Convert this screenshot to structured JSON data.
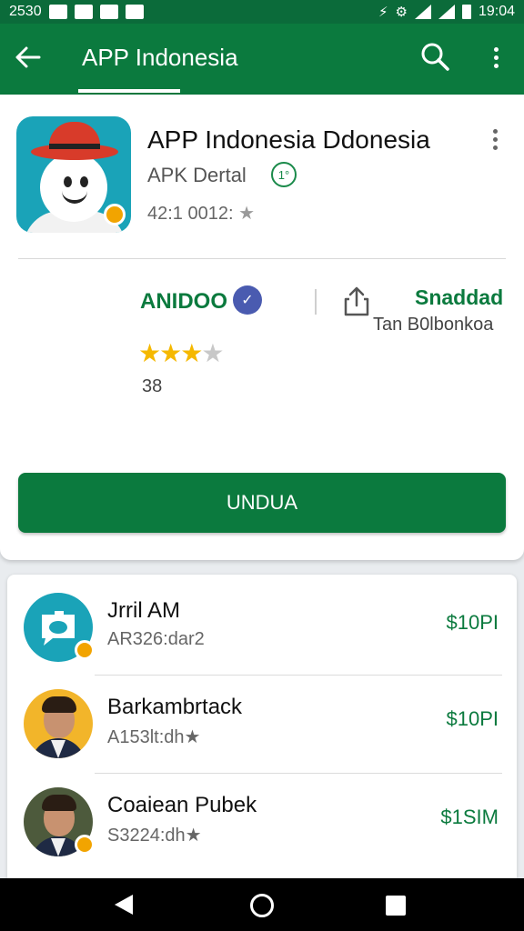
{
  "status_bar": {
    "time_left": "2530",
    "time_right": "19:04",
    "icon_glyph_1": "⚙",
    "icon_glyph_2": "⚡"
  },
  "app_bar": {
    "title": "APP Indonesia"
  },
  "app": {
    "name": "APP Indonesia Ddonesia",
    "subtitle": "APK Dertal",
    "subtitle_badge": "1°",
    "meta": "42:1 0012:",
    "meta_star": "★",
    "developer": "ANIDOO",
    "verified_glyph": "✓",
    "share_label": "Snaddad",
    "share_sub": "Tan B0lbonkoa",
    "rating_stars": [
      "★",
      "★",
      "★",
      "★"
    ],
    "rating_value": 3,
    "rating_count": "38",
    "install_label": "UNDUA"
  },
  "list": [
    {
      "title": "Jrril AM",
      "subtitle": "AR326:dar2",
      "price": "$10PI",
      "avatar": "camera-chat-icon"
    },
    {
      "title": "Barkambrtack",
      "subtitle": "A153lt:dh★",
      "price": "$10PI",
      "avatar": "person-avatar"
    },
    {
      "title": "Coaiean Pubek",
      "subtitle": "S3224:dh★",
      "price": "$1SIM",
      "avatar": "person-avatar"
    }
  ],
  "colors": {
    "primary": "#0b7a3e",
    "status": "#0b6b3a",
    "star": "#f5b800",
    "badge": "#f2a400"
  }
}
